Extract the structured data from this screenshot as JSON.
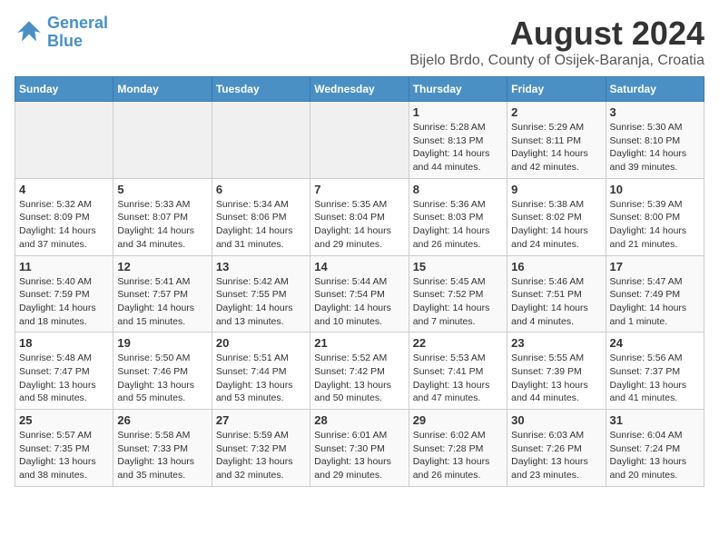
{
  "logo": {
    "line1": "General",
    "line2": "Blue"
  },
  "title": "August 2024",
  "subtitle": "Bijelo Brdo, County of Osijek-Baranja, Croatia",
  "weekdays": [
    "Sunday",
    "Monday",
    "Tuesday",
    "Wednesday",
    "Thursday",
    "Friday",
    "Saturday"
  ],
  "weeks": [
    [
      {
        "day": "",
        "info": ""
      },
      {
        "day": "",
        "info": ""
      },
      {
        "day": "",
        "info": ""
      },
      {
        "day": "",
        "info": ""
      },
      {
        "day": "1",
        "info": "Sunrise: 5:28 AM\nSunset: 8:13 PM\nDaylight: 14 hours and 44 minutes."
      },
      {
        "day": "2",
        "info": "Sunrise: 5:29 AM\nSunset: 8:11 PM\nDaylight: 14 hours and 42 minutes."
      },
      {
        "day": "3",
        "info": "Sunrise: 5:30 AM\nSunset: 8:10 PM\nDaylight: 14 hours and 39 minutes."
      }
    ],
    [
      {
        "day": "4",
        "info": "Sunrise: 5:32 AM\nSunset: 8:09 PM\nDaylight: 14 hours and 37 minutes."
      },
      {
        "day": "5",
        "info": "Sunrise: 5:33 AM\nSunset: 8:07 PM\nDaylight: 14 hours and 34 minutes."
      },
      {
        "day": "6",
        "info": "Sunrise: 5:34 AM\nSunset: 8:06 PM\nDaylight: 14 hours and 31 minutes."
      },
      {
        "day": "7",
        "info": "Sunrise: 5:35 AM\nSunset: 8:04 PM\nDaylight: 14 hours and 29 minutes."
      },
      {
        "day": "8",
        "info": "Sunrise: 5:36 AM\nSunset: 8:03 PM\nDaylight: 14 hours and 26 minutes."
      },
      {
        "day": "9",
        "info": "Sunrise: 5:38 AM\nSunset: 8:02 PM\nDaylight: 14 hours and 24 minutes."
      },
      {
        "day": "10",
        "info": "Sunrise: 5:39 AM\nSunset: 8:00 PM\nDaylight: 14 hours and 21 minutes."
      }
    ],
    [
      {
        "day": "11",
        "info": "Sunrise: 5:40 AM\nSunset: 7:59 PM\nDaylight: 14 hours and 18 minutes."
      },
      {
        "day": "12",
        "info": "Sunrise: 5:41 AM\nSunset: 7:57 PM\nDaylight: 14 hours and 15 minutes."
      },
      {
        "day": "13",
        "info": "Sunrise: 5:42 AM\nSunset: 7:55 PM\nDaylight: 14 hours and 13 minutes."
      },
      {
        "day": "14",
        "info": "Sunrise: 5:44 AM\nSunset: 7:54 PM\nDaylight: 14 hours and 10 minutes."
      },
      {
        "day": "15",
        "info": "Sunrise: 5:45 AM\nSunset: 7:52 PM\nDaylight: 14 hours and 7 minutes."
      },
      {
        "day": "16",
        "info": "Sunrise: 5:46 AM\nSunset: 7:51 PM\nDaylight: 14 hours and 4 minutes."
      },
      {
        "day": "17",
        "info": "Sunrise: 5:47 AM\nSunset: 7:49 PM\nDaylight: 14 hours and 1 minute."
      }
    ],
    [
      {
        "day": "18",
        "info": "Sunrise: 5:48 AM\nSunset: 7:47 PM\nDaylight: 13 hours and 58 minutes."
      },
      {
        "day": "19",
        "info": "Sunrise: 5:50 AM\nSunset: 7:46 PM\nDaylight: 13 hours and 55 minutes."
      },
      {
        "day": "20",
        "info": "Sunrise: 5:51 AM\nSunset: 7:44 PM\nDaylight: 13 hours and 53 minutes."
      },
      {
        "day": "21",
        "info": "Sunrise: 5:52 AM\nSunset: 7:42 PM\nDaylight: 13 hours and 50 minutes."
      },
      {
        "day": "22",
        "info": "Sunrise: 5:53 AM\nSunset: 7:41 PM\nDaylight: 13 hours and 47 minutes."
      },
      {
        "day": "23",
        "info": "Sunrise: 5:55 AM\nSunset: 7:39 PM\nDaylight: 13 hours and 44 minutes."
      },
      {
        "day": "24",
        "info": "Sunrise: 5:56 AM\nSunset: 7:37 PM\nDaylight: 13 hours and 41 minutes."
      }
    ],
    [
      {
        "day": "25",
        "info": "Sunrise: 5:57 AM\nSunset: 7:35 PM\nDaylight: 13 hours and 38 minutes."
      },
      {
        "day": "26",
        "info": "Sunrise: 5:58 AM\nSunset: 7:33 PM\nDaylight: 13 hours and 35 minutes."
      },
      {
        "day": "27",
        "info": "Sunrise: 5:59 AM\nSunset: 7:32 PM\nDaylight: 13 hours and 32 minutes."
      },
      {
        "day": "28",
        "info": "Sunrise: 6:01 AM\nSunset: 7:30 PM\nDaylight: 13 hours and 29 minutes."
      },
      {
        "day": "29",
        "info": "Sunrise: 6:02 AM\nSunset: 7:28 PM\nDaylight: 13 hours and 26 minutes."
      },
      {
        "day": "30",
        "info": "Sunrise: 6:03 AM\nSunset: 7:26 PM\nDaylight: 13 hours and 23 minutes."
      },
      {
        "day": "31",
        "info": "Sunrise: 6:04 AM\nSunset: 7:24 PM\nDaylight: 13 hours and 20 minutes."
      }
    ]
  ]
}
